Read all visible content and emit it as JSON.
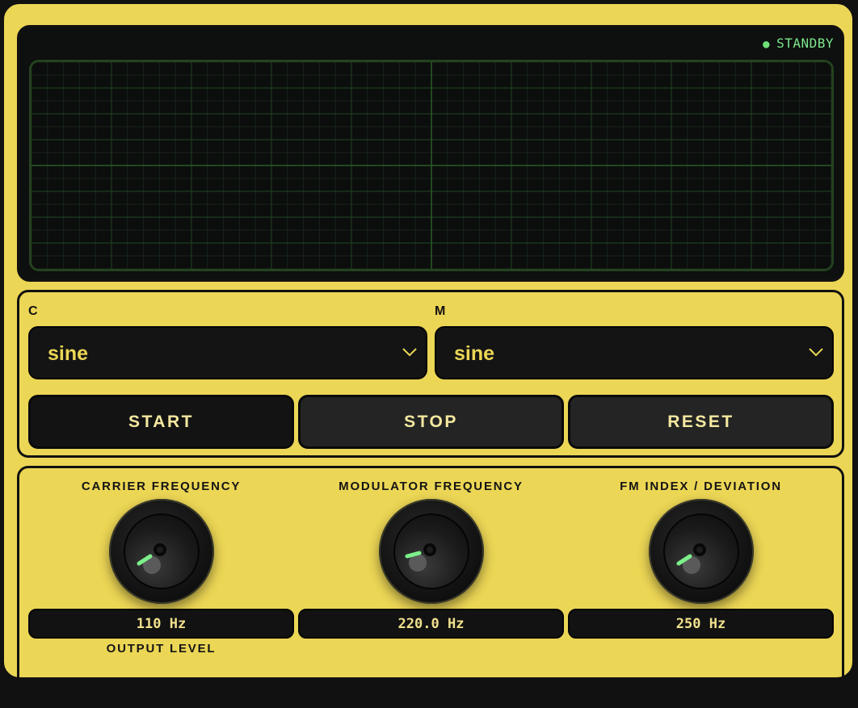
{
  "scope": {
    "status_text": "STANDBY",
    "status_color": "#6ee07a"
  },
  "carrier_select": {
    "label": "C",
    "value": "sine"
  },
  "modulator_select": {
    "label": "M",
    "value": "sine"
  },
  "buttons": {
    "start": "START",
    "stop": "STOP",
    "reset": "RESET"
  },
  "knobs": [
    {
      "label": "CARRIER FREQUENCY",
      "readout": "110 Hz"
    },
    {
      "label": "MODULATOR FREQUENCY",
      "readout": "220.0 Hz"
    },
    {
      "label": "FM INDEX / DEVIATION",
      "readout": "250 Hz"
    },
    {
      "label": "OUTPUT LEVEL"
    }
  ],
  "colors": {
    "panel": "#ecd655",
    "accent_green": "#6ee07a",
    "dark": "#131313"
  }
}
